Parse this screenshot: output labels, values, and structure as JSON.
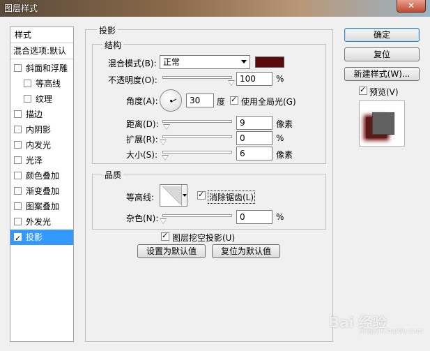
{
  "window": {
    "title": "图层样式",
    "close_label": "✕"
  },
  "left_panel": {
    "styles_header": "样式",
    "blend_options": "混合选项:默认",
    "items": [
      {
        "label": "斜面和浮雕",
        "checked": false
      },
      {
        "label": "等高线",
        "checked": false
      },
      {
        "label": "纹理",
        "checked": false
      },
      {
        "label": "描边",
        "checked": false
      },
      {
        "label": "内阴影",
        "checked": false
      },
      {
        "label": "内发光",
        "checked": false
      },
      {
        "label": "光泽",
        "checked": false
      },
      {
        "label": "颜色叠加",
        "checked": false
      },
      {
        "label": "渐变叠加",
        "checked": false
      },
      {
        "label": "图案叠加",
        "checked": false
      },
      {
        "label": "外发光",
        "checked": false
      },
      {
        "label": "投影",
        "checked": true,
        "selected": true
      }
    ]
  },
  "drop_shadow": {
    "title": "投影",
    "structure": {
      "title": "结构",
      "blend_mode_label": "混合模式(B):",
      "blend_mode_value": "正常",
      "shadow_color": "#5a0a0a",
      "opacity_label": "不透明度(O):",
      "opacity_value": "100",
      "opacity_unit": "%",
      "angle_label": "角度(A):",
      "angle_value": "30",
      "angle_unit": "度",
      "global_light_label": "使用全局光(G)",
      "global_light_checked": true,
      "distance_label": "距离(D):",
      "distance_value": "9",
      "distance_unit": "像素",
      "spread_label": "扩展(R):",
      "spread_value": "0",
      "spread_unit": "%",
      "size_label": "大小(S):",
      "size_value": "6",
      "size_unit": "像素"
    },
    "quality": {
      "title": "品质",
      "contour_label": "等高线:",
      "anti_alias_label": "消除锯齿(L)",
      "anti_alias_checked": true,
      "noise_label": "杂色(N):",
      "noise_value": "0",
      "noise_unit": "%"
    },
    "knockout_label": "图层挖空投影(U)",
    "knockout_checked": true,
    "make_default_label": "设置为默认值",
    "reset_default_label": "复位为默认值"
  },
  "right_panel": {
    "ok_label": "确定",
    "reset_label": "复位",
    "new_style_label": "新建样式(W)...",
    "preview_label": "预览(V)",
    "preview_checked": true
  },
  "watermark": {
    "text": "Bai 经验",
    "sub": "jingyan.baidu.com"
  }
}
